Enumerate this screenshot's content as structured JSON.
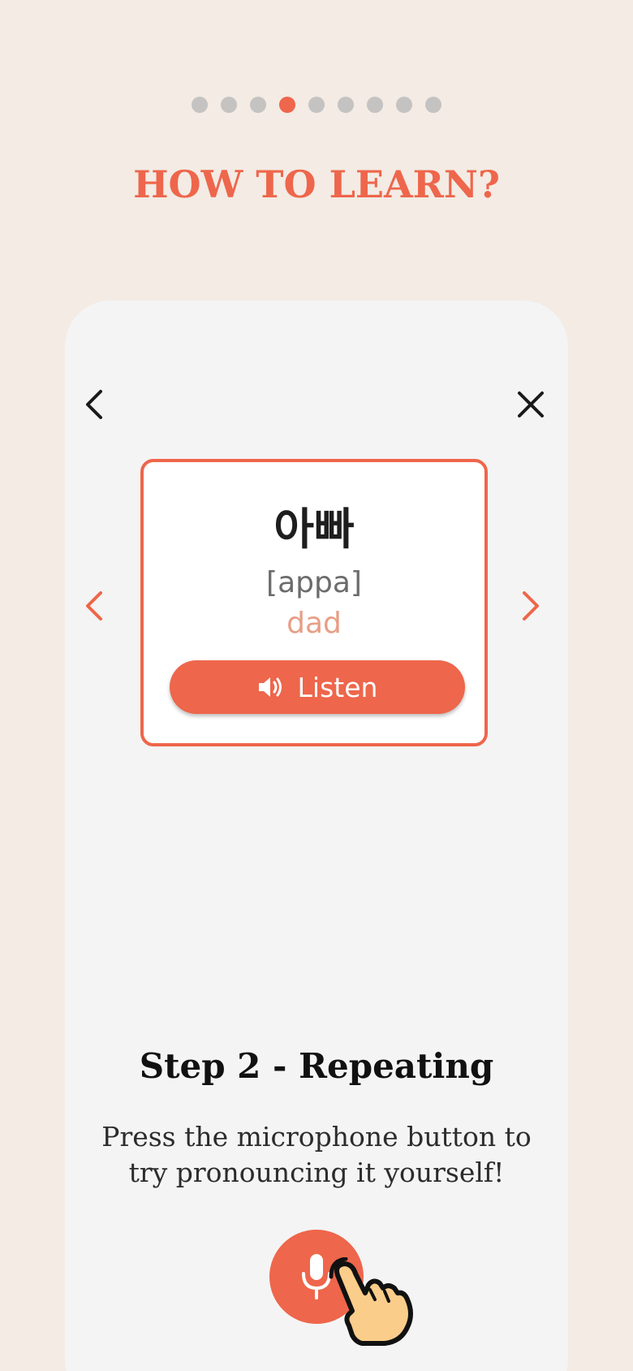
{
  "onboarding": {
    "page_count": 9,
    "active_index": 3,
    "title": "HOW TO LEARN?"
  },
  "card": {
    "word": "아빠",
    "romanization": "[appa]",
    "meaning": "dad",
    "listen_label": "Listen"
  },
  "step": {
    "title": "Step 2 - Repeating",
    "description": "Press the microphone button to try pronouncing it yourself!"
  },
  "icons": {
    "back": "chevron-left-icon",
    "close": "close-icon",
    "prev": "chevron-left-icon",
    "next": "chevron-right-icon",
    "speaker": "speaker-icon",
    "mic": "microphone-icon",
    "hand": "pointing-hand-icon"
  },
  "colors": {
    "accent": "#ee664b",
    "background": "#f3ebe4",
    "panel": "#f4f4f4",
    "dot_inactive": "#c4c3c2",
    "meaning_text": "#e79f86"
  }
}
